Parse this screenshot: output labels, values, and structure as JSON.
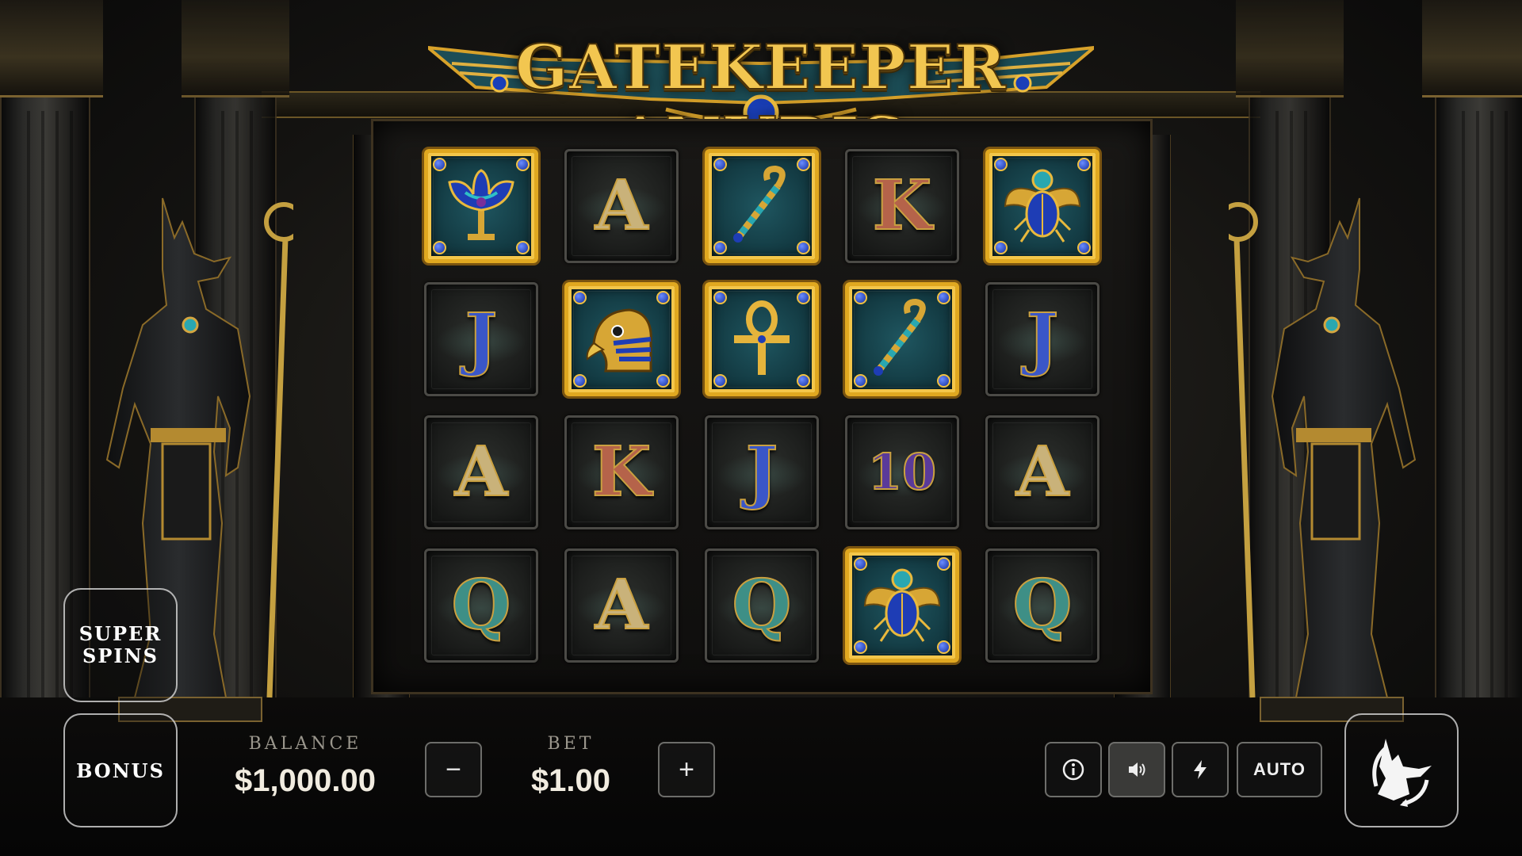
{
  "game": {
    "title": "GATEKEEPER ANUBIS"
  },
  "reels": [
    [
      {
        "symbol": "lotus",
        "label": "",
        "premium": true
      },
      {
        "symbol": "J",
        "label": "J",
        "premium": false
      },
      {
        "symbol": "A",
        "label": "A",
        "premium": false
      },
      {
        "symbol": "Q",
        "label": "Q",
        "premium": false
      }
    ],
    [
      {
        "symbol": "A",
        "label": "A",
        "premium": false
      },
      {
        "symbol": "falcon",
        "label": "",
        "premium": true
      },
      {
        "symbol": "K",
        "label": "K",
        "premium": false
      },
      {
        "symbol": "A",
        "label": "A",
        "premium": false
      }
    ],
    [
      {
        "symbol": "crook",
        "label": "",
        "premium": true
      },
      {
        "symbol": "ankh",
        "label": "",
        "premium": true
      },
      {
        "symbol": "J",
        "label": "J",
        "premium": false
      },
      {
        "symbol": "Q",
        "label": "Q",
        "premium": false
      }
    ],
    [
      {
        "symbol": "K",
        "label": "K",
        "premium": false
      },
      {
        "symbol": "crook",
        "label": "",
        "premium": true
      },
      {
        "symbol": "10",
        "label": "10",
        "premium": false
      },
      {
        "symbol": "scarab",
        "label": "",
        "premium": true
      }
    ],
    [
      {
        "symbol": "scarab",
        "label": "",
        "premium": true
      },
      {
        "symbol": "J",
        "label": "J",
        "premium": false
      },
      {
        "symbol": "A",
        "label": "A",
        "premium": false
      },
      {
        "symbol": "Q",
        "label": "Q",
        "premium": false
      }
    ]
  ],
  "letter_colors": {
    "A": "#c9b27a",
    "K": "#b5634a",
    "J": "#3a56c8",
    "Q": "#3e8f86",
    "10": "#5a3a9a"
  },
  "buttons": {
    "super_spins_line1": "SUPER",
    "super_spins_line2": "SPINS",
    "bonus": "BONUS",
    "minus": "−",
    "plus": "+",
    "auto": "AUTO"
  },
  "balance": {
    "label": "BALANCE",
    "value": "$1,000.00"
  },
  "bet": {
    "label": "BET",
    "value": "$1.00"
  },
  "icons": {
    "info": "info-icon",
    "sound": "sound-icon",
    "turbo": "lightning-icon",
    "spin": "anubis-spin-icon"
  },
  "colors": {
    "gold": "#e0a820",
    "lapis": "#1a3fb8",
    "teal": "#1f5660"
  }
}
